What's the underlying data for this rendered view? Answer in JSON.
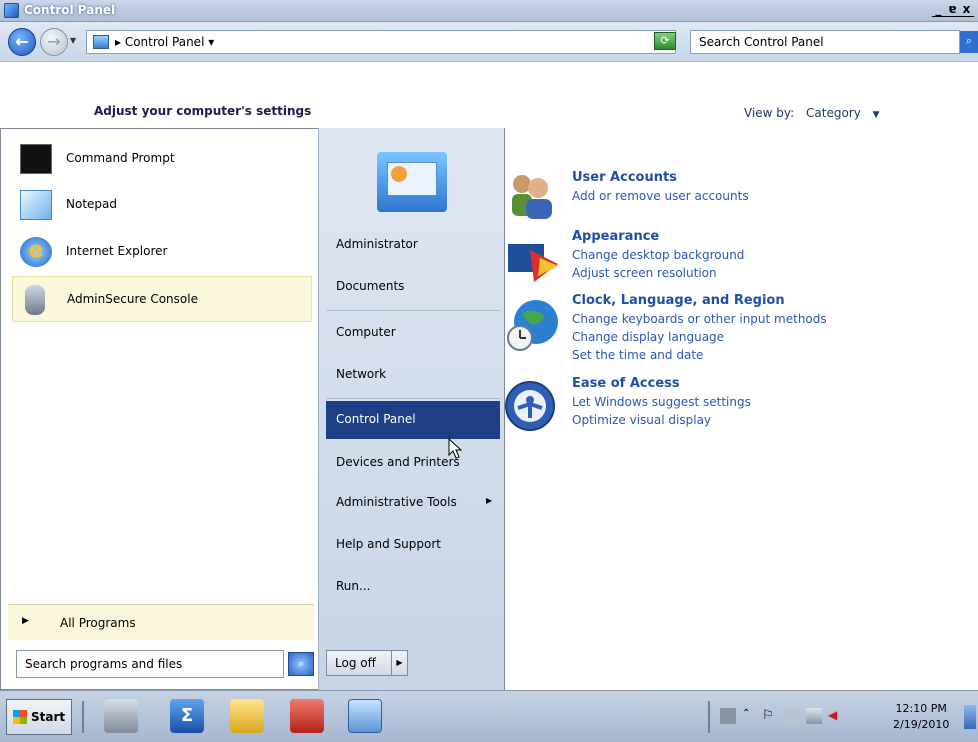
{
  "window": {
    "title": "Control Panel",
    "buttons": [
      "_",
      "ɐ",
      "x"
    ]
  },
  "address": {
    "breadcrumb": "▸ Control Panel ▾",
    "search_placeholder": "Search Control Panel"
  },
  "control_panel": {
    "heading": "Adjust your computer's settings",
    "view_by_label": "View by:",
    "view_by_value": "Category",
    "categories": [
      {
        "title": "User Accounts",
        "links": [
          "Add or remove user accounts"
        ],
        "icon": "users-icon"
      },
      {
        "title": "Appearance",
        "links": [
          "Change desktop background",
          "Adjust screen resolution"
        ],
        "icon": "appearance-icon"
      },
      {
        "title": "Clock, Language, and Region",
        "links": [
          "Change keyboards or other input methods",
          "Change display language",
          "Set the time and date"
        ],
        "icon": "globe-clock-icon"
      },
      {
        "title": "Ease of Access",
        "links": [
          "Let Windows suggest settings",
          "Optimize visual display"
        ],
        "icon": "ease-of-access-icon"
      }
    ]
  },
  "start_menu": {
    "pinned": [
      {
        "label": "Command Prompt",
        "icon": "command-prompt-icon"
      },
      {
        "label": "Notepad",
        "icon": "notepad-icon"
      },
      {
        "label": "Internet Explorer",
        "icon": "internet-explorer-icon"
      },
      {
        "label": "AdminSecure Console",
        "icon": "admin-console-icon"
      }
    ],
    "all_programs": "All Programs",
    "search_placeholder": "Search programs and files",
    "right_items": [
      "Administrator",
      "Documents",
      "Computer",
      "Network",
      "Control Panel",
      "Devices and Printers",
      "Administrative Tools",
      "Help and Support",
      "Run..."
    ],
    "selected_item": "Control Panel",
    "logoff": "Log off"
  },
  "taskbar": {
    "start_label": "Start",
    "clock_time": "12:10 PM",
    "clock_date": "2/19/2010"
  }
}
